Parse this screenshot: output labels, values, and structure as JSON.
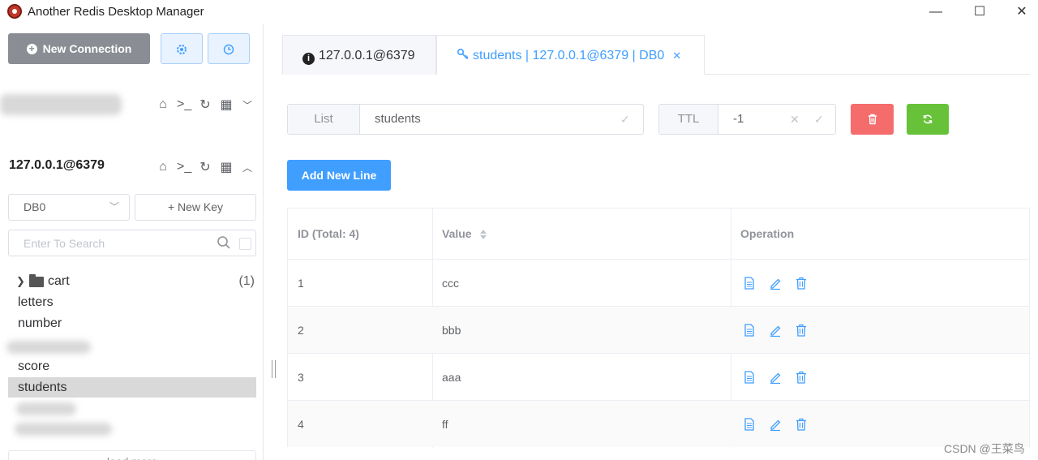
{
  "window": {
    "title": "Another Redis Desktop Manager",
    "controls": {
      "minimize": "—",
      "maximize": "☐",
      "close": "✕"
    }
  },
  "sidebar": {
    "new_connection_label": "New Connection",
    "settings_icon": "settings-icon",
    "history_icon": "clock-icon",
    "connections": [
      {
        "name": "",
        "expanded": false
      },
      {
        "name": "127.0.0.1@6379",
        "expanded": true
      }
    ],
    "db_select": {
      "value": "DB0"
    },
    "new_key_label": "+ New Key",
    "search": {
      "placeholder": "Enter To Search"
    },
    "tree": [
      {
        "label": "cart",
        "type": "folder",
        "count": "(1)"
      },
      {
        "label": "letters",
        "type": "key"
      },
      {
        "label": "number",
        "type": "key"
      },
      {
        "label": "score",
        "type": "key"
      },
      {
        "label": "students",
        "type": "key",
        "active": true
      }
    ],
    "load_more_label": "load more"
  },
  "tabs": [
    {
      "label": "127.0.0.1@6379",
      "icon": "info-icon",
      "active": false
    },
    {
      "label": "students | 127.0.0.1@6379 | DB0",
      "icon": "key-icon",
      "active": true,
      "closable": true
    }
  ],
  "key_header": {
    "type_label": "List",
    "key_name": "students",
    "ttl_label": "TTL",
    "ttl_value": "-1"
  },
  "add_new_line_label": "Add New Line",
  "table": {
    "headers": {
      "id": "ID (Total: 4)",
      "value": "Value",
      "operation": "Operation"
    },
    "rows": [
      {
        "id": "1",
        "value": "ccc"
      },
      {
        "id": "2",
        "value": "bbb"
      },
      {
        "id": "3",
        "value": "aaa"
      },
      {
        "id": "4",
        "value": "ff"
      }
    ]
  },
  "watermark": "CSDN @王菜鸟",
  "colors": {
    "primary": "#409eff",
    "danger": "#f56c6c",
    "success": "#67c23a",
    "sidebar_button": "#8a8d93"
  }
}
